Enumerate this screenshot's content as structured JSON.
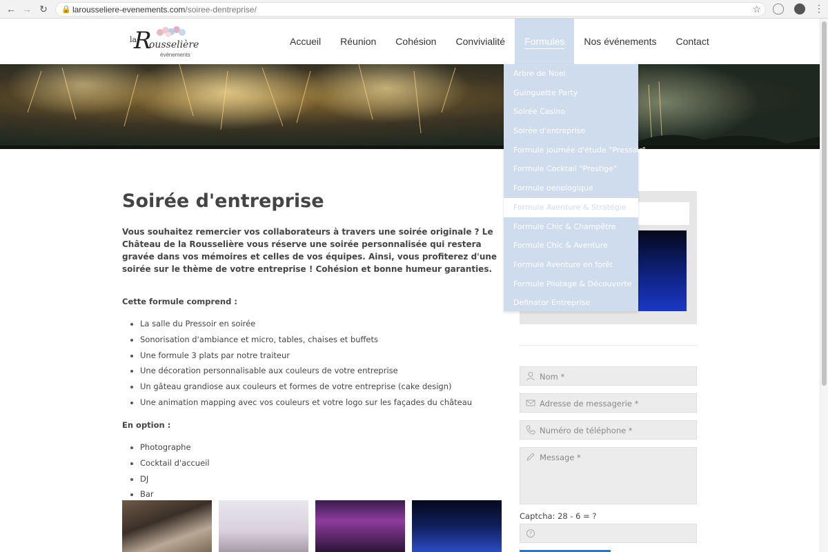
{
  "browser": {
    "url_domain": "larousseliere-evenements.com",
    "url_path": "/soiree-dentreprise/"
  },
  "logo": {
    "la": "la",
    "R": "R",
    "rest": "ousselière",
    "sub": "événements"
  },
  "nav": {
    "items": [
      "Accueil",
      "Réunion",
      "Cohésion",
      "Convivialité",
      "Formules",
      "Nos événements",
      "Contact"
    ],
    "active": "Formules"
  },
  "dropdown": {
    "items": [
      "Arbre de Noel",
      "Guinguette Party",
      "Soirée Casino",
      "Soirée d'entreprise",
      "Formule journée d'étude \"Pressoir\"",
      "Formule Cocktail \"Prestige\"",
      "Formule oenologique",
      "Formule Aventure & Stratégie",
      "Formule Chic & Champêtre",
      "Formule Chic & Aventure",
      "Formule Aventure en forêt",
      "Formule Pilotage & Découverte",
      "Definator Entreprise"
    ],
    "hovered": "Formule Aventure & Stratégie"
  },
  "content": {
    "title": "Soirée d'entreprise",
    "intro": "Vous souhaitez remercier vos collaborateurs à travers une soirée originale ? Le Château de la Rousselière vous réserve une soirée personnalisée qui restera gravée dans vos mémoires et celles de vos équipes. Ainsi, vous profiterez d'une soirée sur le thème de votre entreprise ! Cohésion et bonne humeur garanties.",
    "includes_label": "Cette formule comprend :",
    "includes": [
      "La salle du Pressoir en soirée",
      "Sonorisation d'ambiance et micro, tables, chaises et buffets",
      "Une formule 3 plats par notre traiteur",
      "Une décoration personnalisable aux couleurs de votre entreprise",
      "Un gâteau grandiose aux couleurs et formes de votre entreprise (cake design)",
      "Une animation mapping avec vos couleurs et votre logo sur les façades du château"
    ],
    "options_label": "En option :",
    "options": [
      "Photographe",
      "Cocktail d'accueil",
      "DJ",
      "Bar"
    ]
  },
  "form": {
    "name_placeholder": "Nom *",
    "email_placeholder": "Adresse de messagerie *",
    "phone_placeholder": "Numéro de téléphone *",
    "message_placeholder": "Message *",
    "captcha_label": "Captcha: 28 - 6 = ?",
    "captcha_icon": "?"
  },
  "icons": {
    "user": "user-icon",
    "mail": "mail-icon",
    "phone": "phone-icon",
    "pencil": "pencil-icon",
    "question": "question-icon"
  },
  "colors": {
    "nav_active_bg": "#cfdcee",
    "text": "#444444",
    "field_bg": "#ececec"
  }
}
